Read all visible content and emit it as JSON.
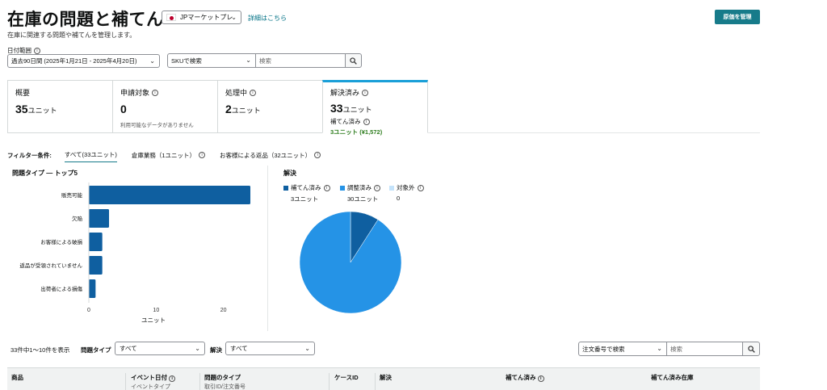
{
  "header": {
    "title": "在庫の問題と補てん",
    "subtitle": "在庫に関連する問題や補てんを管理します。",
    "market": "JPマーケットプレ",
    "details_link": "詳細はこちら",
    "manage_button": "原価を管理"
  },
  "date_range": {
    "label": "日付範囲",
    "value": "過去90日間 (2025年1月21日 - 2025年4月20日)"
  },
  "search": {
    "type": "SKUで検索",
    "placeholder": "検索"
  },
  "cards": [
    {
      "title": "概要",
      "value": "35",
      "unit": "ユニット"
    },
    {
      "title": "申請対象",
      "value": "0",
      "note": "利用可能なデータがありません"
    },
    {
      "title": "処理中",
      "value": "2",
      "unit": "ユニット"
    },
    {
      "title": "解決済み",
      "value": "33",
      "unit": "ユニット",
      "sub_label": "補てん済み",
      "sub_value": "3ユニット (¥1,572)"
    }
  ],
  "filters": {
    "label": "フィルター条件:",
    "items": [
      "すべて(33ユニット)",
      "倉庫業務（1ユニット）",
      "お客様による返品（32ユニット）"
    ]
  },
  "chart_data": [
    {
      "type": "bar",
      "title": "問題タイプ — トップ5",
      "categories": [
        "販売可能",
        "欠陥",
        "お客様による破損",
        "返品が受領されていません",
        "出荷者による損傷"
      ],
      "values": [
        24,
        3,
        2,
        2,
        1
      ],
      "xlabel": "ユニット",
      "ticks": [
        0,
        10,
        20
      ],
      "xlim": [
        0,
        24
      ],
      "color": "#0f5fa0"
    },
    {
      "type": "pie",
      "title": "解決",
      "series": [
        {
          "name": "補てん済み",
          "value": 3,
          "label": "3ユニット",
          "color": "#0f5fa0"
        },
        {
          "name": "調整済み",
          "value": 30,
          "label": "30ユニット",
          "color": "#2593e6"
        },
        {
          "name": "対象外",
          "value": 0,
          "label": "0",
          "color": "#c4e3fb"
        }
      ]
    }
  ],
  "table": {
    "count": "33件中1～10件を表示",
    "issue_type_label": "問題タイプ",
    "issue_type_value": "すべて",
    "resolution_label": "解決",
    "resolution_value": "すべて",
    "order_search_type": "注文番号で検索",
    "order_search_placeholder": "検索",
    "columns": [
      {
        "label": "商品",
        "sub": ""
      },
      {
        "label": "イベント日付",
        "sub": "イベントタイプ"
      },
      {
        "label": "問題のタイプ",
        "sub": "取引ID/注文番号"
      },
      {
        "label": "ケースID",
        "sub": ""
      },
      {
        "label": "解決",
        "sub": ""
      },
      {
        "label": "補てん済み",
        "sub": ""
      },
      {
        "label": "補てん済み在庫",
        "sub": ""
      }
    ]
  }
}
